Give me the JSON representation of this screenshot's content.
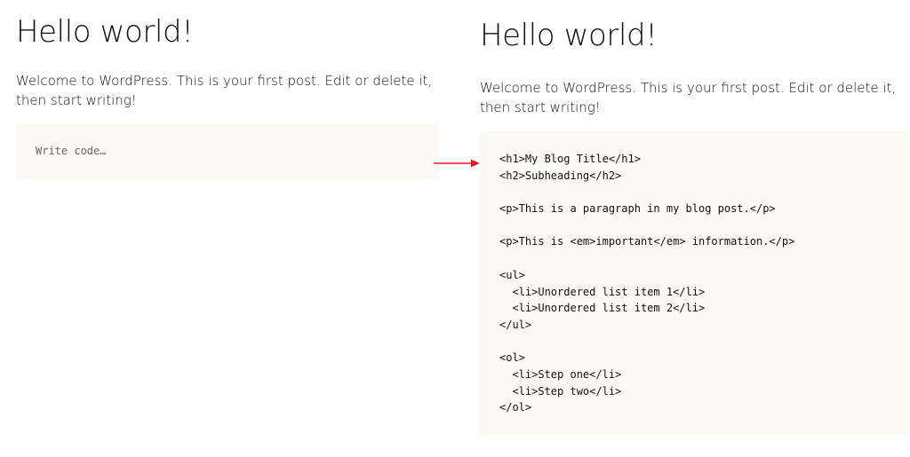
{
  "left_post": {
    "title": "Hello world!",
    "intro_line1": "Welcome to WordPress. This is your first post. Edit or delete it,",
    "intro_line2": "then start writing!",
    "code_placeholder": "Write code…"
  },
  "right_post": {
    "title": "Hello world!",
    "intro_line1": "Welcome to WordPress. This is your first post. Edit or delete it,",
    "intro_line2": "then start writing!",
    "code_lines": [
      "<h1>My Blog Title</h1>",
      "<h2>Subheading</h2>",
      "",
      "<p>This is a paragraph in my blog post.</p>",
      "",
      "<p>This is <em>important</em> information.</p>",
      "",
      "<ul>",
      "  <li>Unordered list item 1</li>",
      "  <li>Unordered list item 2</li>",
      "</ul>",
      "",
      "<ol>",
      "  <li>Step one</li>",
      "  <li>Step two</li>",
      "</ol>"
    ]
  },
  "colors": {
    "code_background": "#fbfaf4",
    "arrow": "#e02020"
  },
  "icons": {
    "arrow": "right-arrow-icon"
  }
}
